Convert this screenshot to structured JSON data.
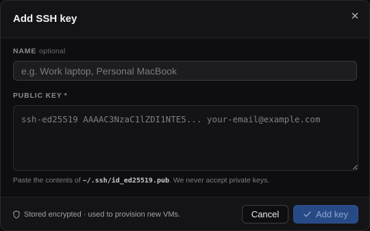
{
  "dialog": {
    "title": "Add SSH key"
  },
  "name_field": {
    "label": "NAME",
    "optional_tag": "optional",
    "value": "",
    "placeholder": "e.g. Work laptop, Personal MacBook"
  },
  "key_field": {
    "label": "PUBLIC KEY",
    "required_marker": "*",
    "value": "",
    "placeholder": "ssh-ed25519 AAAAC3NzaC1lZDI1NTE5... your-email@example.com"
  },
  "hint": {
    "prefix": "Paste the contents of ",
    "path": "~/.ssh/id_ed25519.pub",
    "suffix": ". We never accept private keys."
  },
  "footer": {
    "note_icon": "shield-icon",
    "note": "Stored encrypted · used to provision new VMs.",
    "cancel_label": "Cancel",
    "submit_icon": "check-icon",
    "submit_label": "Add key",
    "submit_disabled": true
  },
  "colors": {
    "background": "#0e0e10",
    "panel": "#141416",
    "accent_disabled": "#274a86"
  }
}
